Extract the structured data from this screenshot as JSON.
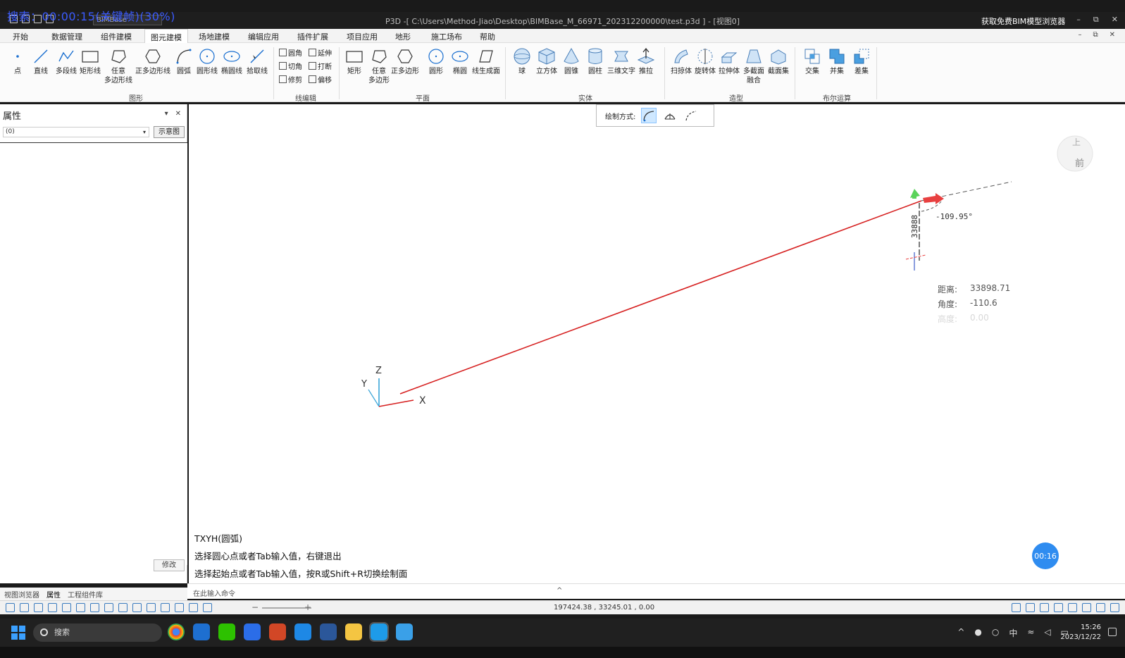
{
  "overlay": {
    "recording_text": "搜索：00:00:15(关键帧)(30%)"
  },
  "window": {
    "title": "P3D -[ C:\\Users\\Method-Jiao\\Desktop\\BIMBase_M_66971_202312200000\\test.p3d ] - [视图0]",
    "combo_value": "BIMBase",
    "promo_text": "获取免费BIM模型浏览器",
    "minimize": "–",
    "restore": "⧉",
    "close": "✕"
  },
  "menu": {
    "tabs": [
      "开始",
      "数据管理",
      "组件建模",
      "图元建模",
      "场地建模",
      "编辑应用",
      "插件扩展",
      "项目应用",
      "地形",
      "施工场布",
      "帮助"
    ],
    "active": "图元建模"
  },
  "ribbon": {
    "shape_tools": [
      "点",
      "直线",
      "多段线",
      "矩形线",
      "任意\n多边形线",
      "正多边形线",
      "圆弧",
      "圆形线",
      "椭圆线",
      "拾取线"
    ],
    "line_edit_tools": [
      "圆角",
      "延伸",
      "切角",
      "打断",
      "修剪",
      "偏移"
    ],
    "plane_tools": [
      "矩形",
      "任意\n多边形",
      "正多边形",
      "圆形",
      "椭圆",
      "线生成面"
    ],
    "solid_tools": [
      "球",
      "立方体",
      "圆锥",
      "圆柱",
      "三维文字",
      "推拉"
    ],
    "model_tools": [
      "扫掠体",
      "旋转体",
      "拉伸体",
      "多截面\n融合",
      "截面集"
    ],
    "boolean_tools": [
      "交集",
      "并集",
      "差集"
    ],
    "groups": {
      "shape": "图形",
      "line_edit": "线编辑",
      "plane": "平面",
      "solid": "实体",
      "model": "造型",
      "boolean": "布尔运算"
    }
  },
  "properties_panel": {
    "title": "属性",
    "combo_value": "(0)",
    "schematic_button": "示意图",
    "modify_button": "修改",
    "tabs": [
      "视图浏览器",
      "属性",
      "工程组件库"
    ],
    "active_tab": "属性"
  },
  "viewport": {
    "draw_mode_label": "绘制方式:",
    "angle_label": "-109.95°",
    "dimension_label": "33888",
    "readout": {
      "distance_label": "距离:",
      "distance_value": "33898.71",
      "angle_label": "角度:",
      "angle_value": "-110.6",
      "height_label": "高度:",
      "height_value": "0.00"
    },
    "axis": {
      "x": "X",
      "y": "Y",
      "z": "Z"
    },
    "navcube": {
      "top": "上",
      "front": "前"
    },
    "command_output": [
      "TXYH(圆弧)",
      "选择圆心点或者Tab输入值，右键退出",
      "选择起始点或者Tab输入值，按R或Shift+R切换绘制面"
    ],
    "timer": "00:16"
  },
  "command_bar": {
    "placeholder": "在此输入命令",
    "caret": "^"
  },
  "status_bar": {
    "coordinates": "197424.38 , 33245.01 , 0.00",
    "zoom_minus": "−",
    "zoom_plus": "+"
  },
  "taskbar": {
    "search_placeholder": "搜索",
    "tray_lang": "中",
    "time": "15:26",
    "date": "2023/12/22"
  },
  "colors": {
    "accent": "#2f8cf0",
    "line": "#d62020",
    "dim_arrow": "#e84040",
    "up_arrow": "#5ad35a"
  }
}
